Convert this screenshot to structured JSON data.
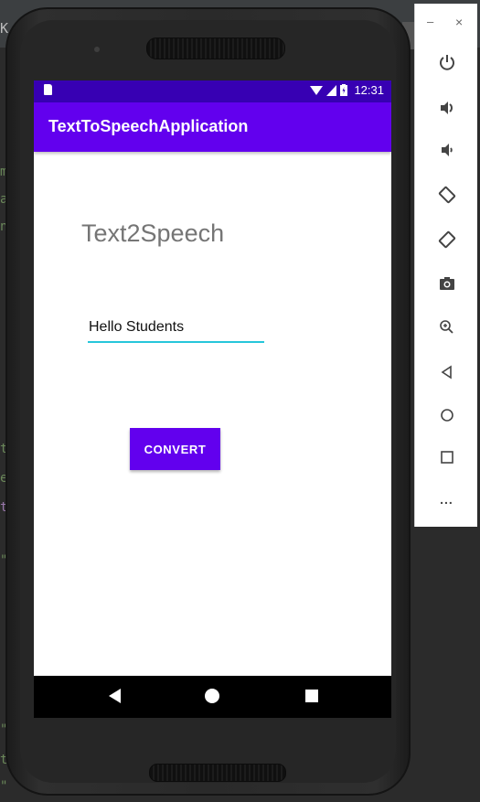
{
  "ide": {
    "title_fragment": "K A",
    "code_fragments": [
      "ma",
      "ap",
      "n/",
      "t\"",
      "e\"",
      "tr",
      "\"",
      "t\"",
      "\"",
      "\""
    ]
  },
  "status_bar": {
    "time": "12:31"
  },
  "app": {
    "title": "TextToSpeechApplication",
    "heading": "Text2Speech",
    "input_value": "Hello Students",
    "convert_label": "CONVERT"
  },
  "colors": {
    "primary": "#6200ee",
    "primary_dark": "#3700b3",
    "accent": "#26c6da"
  },
  "toolbar": {
    "minimize_label": "–",
    "close_label": "×",
    "items": [
      "power-icon",
      "volume-up-icon",
      "volume-down-icon",
      "rotate-left-icon",
      "rotate-right-icon",
      "screenshot-icon",
      "zoom-icon",
      "back-icon",
      "home-icon",
      "overview-icon",
      "more-icon"
    ],
    "more_label": "..."
  }
}
